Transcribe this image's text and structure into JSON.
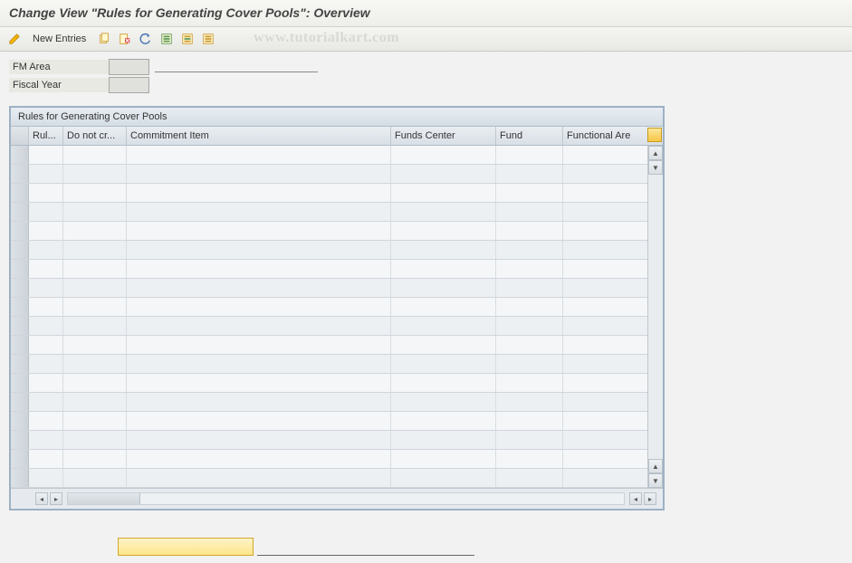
{
  "title": "Change View \"Rules for Generating Cover Pools\": Overview",
  "toolbar": {
    "new_entries": "New Entries"
  },
  "watermark": "www.tutorialkart.com",
  "fields": {
    "fm_area_label": "FM Area",
    "fm_area_value": "",
    "fiscal_year_label": "Fiscal Year",
    "fiscal_year_value": ""
  },
  "grid": {
    "title": "Rules for Generating Cover Pools",
    "columns": {
      "rule": "Rul...",
      "do_not_create": "Do not cr...",
      "commitment_item": "Commitment Item",
      "funds_center": "Funds Center",
      "fund": "Fund",
      "functional_area": "Functional Are"
    }
  },
  "bottom_input_value": ""
}
